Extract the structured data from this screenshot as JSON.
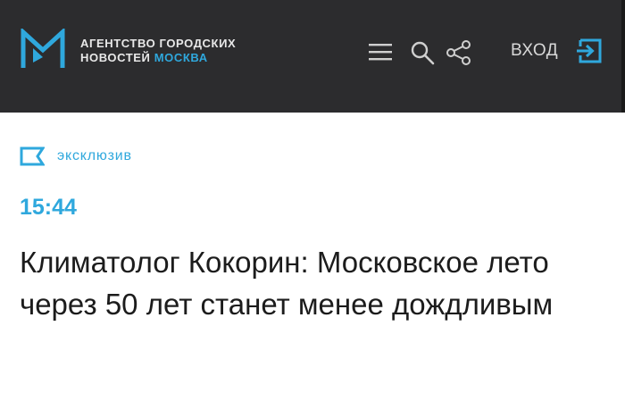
{
  "header": {
    "brand_line1": "АГЕНТСТВО ГОРОДСКИХ",
    "brand_line2": "НОВОСТЕЙ",
    "brand_accent": "МОСКВА",
    "login_label": "ВХОД",
    "icons": [
      "logo-m-icon",
      "menu-icon",
      "search-icon",
      "share-icon",
      "login-icon"
    ]
  },
  "article": {
    "tag": "эксклюзив",
    "time": "15:44",
    "headline": "Климатолог Кокорин: Московское лето через 50 лет станет менее дождливым"
  },
  "colors": {
    "header_bg": "#2c2c2e",
    "accent": "#2fa8dd",
    "text": "#1c1c1c"
  }
}
